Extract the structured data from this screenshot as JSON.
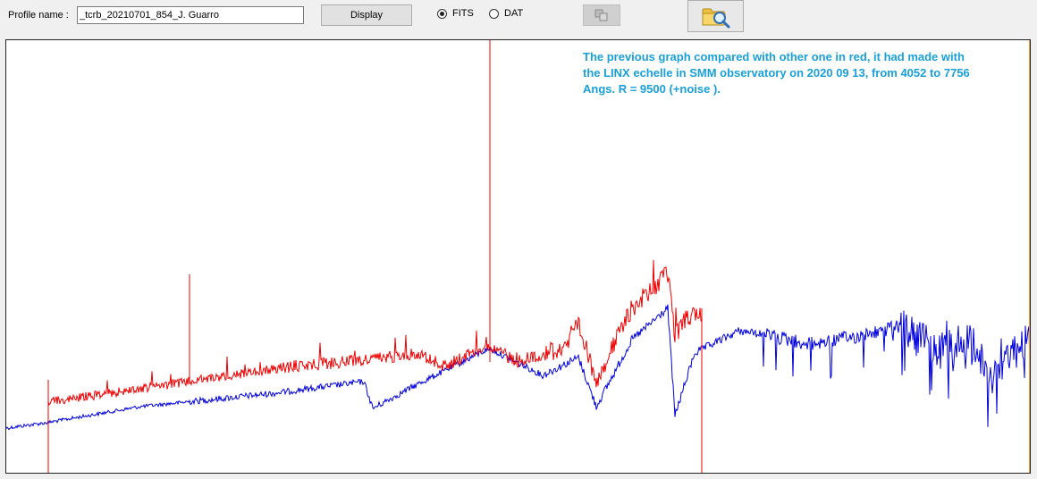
{
  "toolbar": {
    "profile_label": "Profile name :",
    "profile_value": "_tcrb_20210701_854_J. Guarro",
    "display_label": "Display",
    "radio_fits_label": "FITS",
    "radio_dat_label": "DAT",
    "selected_format": "FITS"
  },
  "icons": {
    "copy": "copy-icon",
    "open": "folder-search-icon"
  },
  "plot": {
    "annotation": "The previous graph compared with other one in red, it had made with\nthe LINX echelle in SMM observatory on 2020 09 13,  from 4052 to 7756\nAngs. R = 9500 (+noise ).",
    "colors": {
      "blue_series": "#0000dd",
      "red_series": "#ee0000",
      "annotation": "#1aa0d8",
      "frame_right": "#f3a13a"
    }
  }
}
